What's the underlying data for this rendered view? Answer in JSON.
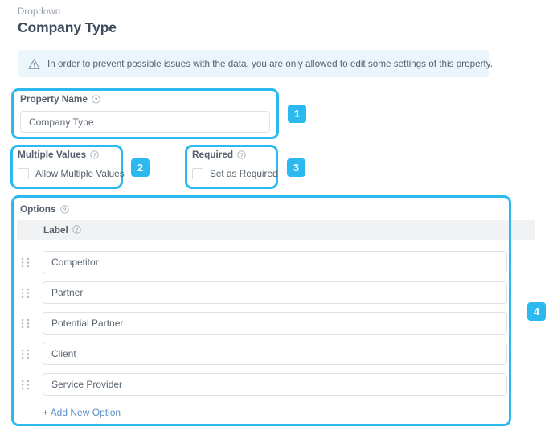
{
  "header": {
    "eyebrow": "Dropdown",
    "title": "Company Type"
  },
  "alert": {
    "icon": "warning-triangle-icon",
    "text": "In order to prevent possible issues with the data, you are only allowed to edit some settings of this property.",
    "background_color": "#eaf6fb"
  },
  "highlight_color": "#2bb9ef",
  "badges": [
    {
      "number": "1"
    },
    {
      "number": "2"
    },
    {
      "number": "3"
    },
    {
      "number": "4"
    }
  ],
  "property_name": {
    "label": "Property Name",
    "help_icon": "help-circle-icon",
    "value": "Company Type",
    "placeholder": "Property Name"
  },
  "multiple_values": {
    "label": "Multiple Values",
    "help_icon": "help-circle-icon",
    "checkbox_label": "Allow Multiple Values",
    "checked": false
  },
  "required": {
    "label": "Required",
    "help_icon": "help-circle-icon",
    "checkbox_label": "Set as Required",
    "checked": false
  },
  "options": {
    "label": "Options",
    "help_icon": "help-circle-icon",
    "column_header": "Label",
    "column_header_help_icon": "help-circle-icon",
    "drag_handle_icon": "drag-handle-icon",
    "items": [
      {
        "value": "Competitor"
      },
      {
        "value": "Partner"
      },
      {
        "value": "Potential Partner"
      },
      {
        "value": "Client"
      },
      {
        "value": "Service Provider"
      }
    ],
    "add_link": "+ Add New Option"
  }
}
